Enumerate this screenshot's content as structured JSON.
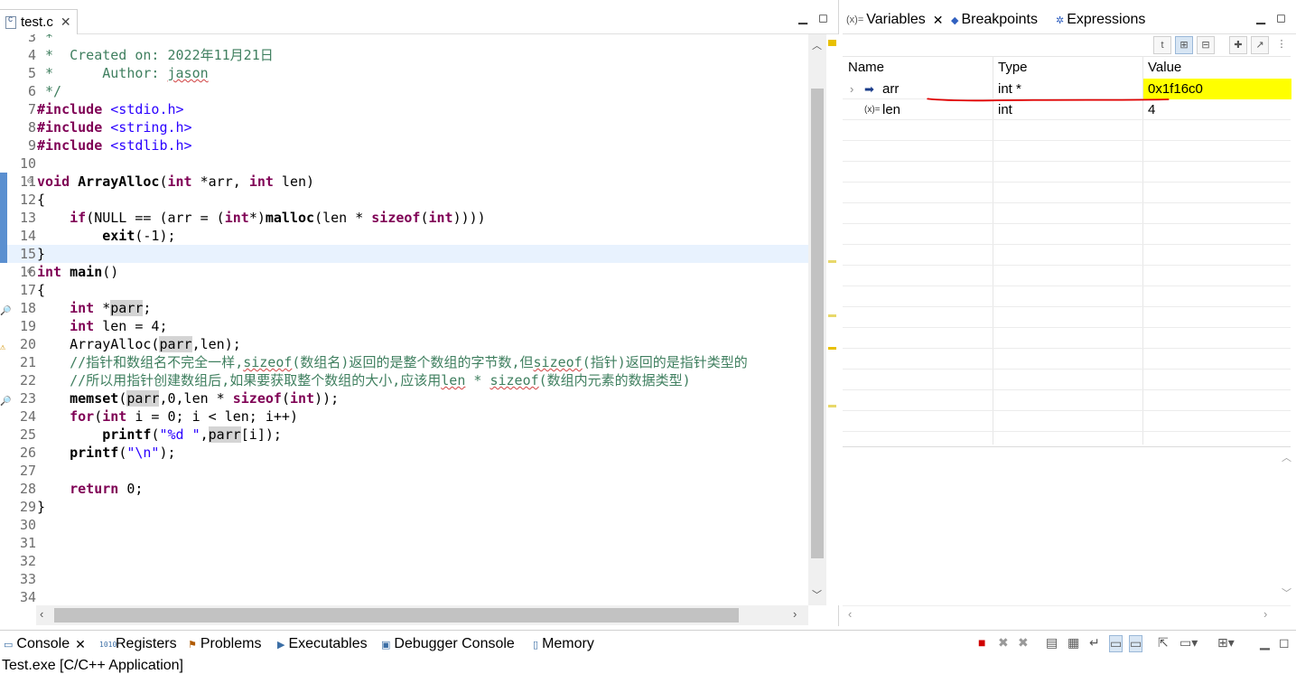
{
  "editor": {
    "tab_label": "test.c",
    "tab_close": "✕",
    "lines": [
      {
        "n": "3",
        "html": "<span class=\"cm\"> *</span>"
      },
      {
        "n": "4",
        "html": "<span class=\"cm\"> *  Created on: 2022年11月21日</span>"
      },
      {
        "n": "5",
        "html": "<span class=\"cm\"> *      Author: <span class=\"squig\">jason</span></span>"
      },
      {
        "n": "6",
        "html": "<span class=\"cm\"> */</span>"
      },
      {
        "n": "7",
        "html": "<span class=\"kw\">#include</span> <span class=\"st\">&lt;stdio.h&gt;</span>"
      },
      {
        "n": "8",
        "html": "<span class=\"kw\">#include</span> <span class=\"st\">&lt;string.h&gt;</span>"
      },
      {
        "n": "9",
        "html": "<span class=\"kw\">#include</span> <span class=\"st\">&lt;stdlib.h&gt;</span>"
      },
      {
        "n": "10",
        "html": ""
      },
      {
        "n": "11",
        "html": "<span class=\"kw\">void</span> <b>ArrayAlloc</b>(<span class=\"kw\">int</span> *arr, <span class=\"kw\">int</span> len)",
        "fold": true
      },
      {
        "n": "12",
        "html": "{"
      },
      {
        "n": "13",
        "html": "    <span class=\"kw\">if</span>(NULL == (arr = (<span class=\"kw\">int</span>*)<b>malloc</b>(len * <span class=\"kw\">sizeof</span>(<span class=\"kw\">int</span>))))"
      },
      {
        "n": "14",
        "html": "        <b>exit</b>(-1);"
      },
      {
        "n": "15",
        "html": "}",
        "current": true
      },
      {
        "n": "16",
        "html": "<span class=\"kw\">int</span> <b>main</b>()",
        "fold": true
      },
      {
        "n": "17",
        "html": "{"
      },
      {
        "n": "18",
        "html": "    <span class=\"kw\">int</span> *<span class=\"hl\">parr</span>;",
        "mark": "🔎"
      },
      {
        "n": "19",
        "html": "    <span class=\"kw\">int</span> len = 4;"
      },
      {
        "n": "20",
        "html": "    ArrayAlloc(<span class=\"hl\">parr</span>,len);",
        "mark": "⚠"
      },
      {
        "n": "21",
        "html": "    <span class=\"cm\">//指针和数组名不完全一样,<span class=\"squig\">sizeof</span>(数组名)返回的是整个数组的字节数,但<span class=\"squig\">sizeof</span>(指针)返回的是指针类型的</span>"
      },
      {
        "n": "22",
        "html": "    <span class=\"cm\">//所以用指针创建数组后,如果要获取整个数组的大小,应该用<span class=\"squig\">len</span> * <span class=\"squig\">sizeof</span>(数组内元素的数据类型)</span>"
      },
      {
        "n": "23",
        "html": "    <b>memset</b>(<span class=\"hl\">parr</span>,0,len * <span class=\"kw\">sizeof</span>(<span class=\"kw\">int</span>));",
        "mark": "🔎"
      },
      {
        "n": "24",
        "html": "    <span class=\"kw\">for</span>(<span class=\"kw\">int</span> i = 0; i &lt; len; i++)"
      },
      {
        "n": "25",
        "html": "        <b>printf</b>(<span class=\"st\">\"%d \"</span>,<span class=\"hl\">parr</span>[i]);"
      },
      {
        "n": "26",
        "html": "    <b>printf</b>(<span class=\"st\">\"\\n\"</span>);"
      },
      {
        "n": "27",
        "html": ""
      },
      {
        "n": "28",
        "html": "    <span class=\"kw\">return</span> 0;"
      },
      {
        "n": "29",
        "html": "}"
      },
      {
        "n": "30",
        "html": ""
      },
      {
        "n": "31",
        "html": ""
      },
      {
        "n": "32",
        "html": ""
      },
      {
        "n": "33",
        "html": ""
      },
      {
        "n": "34",
        "html": ""
      }
    ]
  },
  "variables": {
    "tabs": [
      {
        "label": "Variables",
        "icon": "(x)="
      },
      {
        "label": "Breakpoints",
        "icon": "◆"
      },
      {
        "label": "Expressions",
        "icon": "✲"
      }
    ],
    "columns": [
      "Name",
      "Type",
      "Value"
    ],
    "rows": [
      {
        "name": "arr",
        "type": "int *",
        "value": "0x1f16c0",
        "icon": "➡",
        "expander": "›",
        "highlight": true
      },
      {
        "name": "len",
        "type": "int",
        "value": "4",
        "icon": "(x)="
      }
    ],
    "close": "✕"
  },
  "console": {
    "tabs": [
      {
        "label": "Console",
        "icon": "▭",
        "close": "✕"
      },
      {
        "label": "Registers",
        "icon": "1010"
      },
      {
        "label": "Problems",
        "icon": "⚑"
      },
      {
        "label": "Executables",
        "icon": "▶"
      },
      {
        "label": "Debugger Console",
        "icon": "▣"
      },
      {
        "label": "Memory",
        "icon": "▯"
      }
    ],
    "status": "Test.exe [C/C++ Application]"
  },
  "colors": {
    "keyword": "#7f0055",
    "comment": "#3f7f5f",
    "string": "#2a00ff",
    "value_highlight": "#ffff00",
    "annotation_red": "#e00000"
  }
}
